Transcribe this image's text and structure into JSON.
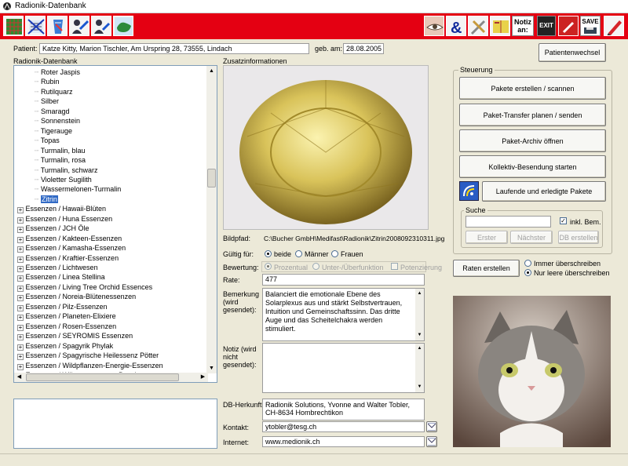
{
  "window": {
    "title": "Radionik-Datenbank"
  },
  "toolbar": {
    "notiz_label": "Notiz an:",
    "exit_label": "EXIT",
    "save_label": "SAVE"
  },
  "patient": {
    "label": "Patient:",
    "value": "Katze Kitty, Marion Tischler, Am Urspring 28, 73555, Lindach",
    "dob_label": "geb. am:",
    "dob_value": "28.08.2005",
    "switch_button": "Patientenwechsel"
  },
  "db_panel": {
    "label": "Radionik-Datenbank"
  },
  "tree": {
    "children": [
      "Roter Jaspis",
      "Rubin",
      "Rutilquarz",
      "Silber",
      "Smaragd",
      "Sonnenstein",
      "Tigerauge",
      "Topas",
      "Turmalin, blau",
      "Turmalin, rosa",
      "Turmalin, schwarz",
      "Violetter Sugilith",
      "Wassermelonen-Turmalin"
    ],
    "selected": "Zitrin",
    "groups": [
      "Essenzen / Hawaii-Blüten",
      "Essenzen / Huna Essenzen",
      "Essenzen / JCH Öle",
      "Essenzen / Kakteen-Essenzen",
      "Essenzen / Kamasha-Essenzen",
      "Essenzen / Kraftier-Essenzen",
      "Essenzen / Lichtwesen",
      "Essenzen / Linea Stellina",
      "Essenzen / Living Tree Orchid Essences",
      "Essenzen / Noreia-Blütenessenzen",
      "Essenzen / Pilz-Essenzen",
      "Essenzen / Planeten-Elixiere",
      "Essenzen / Rosen-Essenzen",
      "Essenzen / SEYROMIS Essenzen",
      "Essenzen / Spagyrik Phylak",
      "Essenzen / Spagyrische Heilessenz Pötter",
      "Essenzen / Wildpflanzen-Energie-Essenzen",
      "Essenzen / Wüstenessenzen Boavistas"
    ]
  },
  "info": {
    "label": "Zusatzinformationen",
    "bildpfad_label": "Bildpfad:",
    "bildpfad_value": "C:\\Bucher GmbH\\Medifast\\Radionik\\Zitrin2008092310311.jpg",
    "gueltig_label": "Gültig für:",
    "gueltig_options": [
      "beide",
      "Männer",
      "Frauen"
    ],
    "bewertung_label": "Bewertung:",
    "bewertung_options": [
      "Prozentual",
      "Unter-/Überfunktion",
      "Potenzierung"
    ],
    "rate_label": "Rate:",
    "rate_value": "477",
    "bemerkung_label": "Bemerkung (wird gesendet):",
    "bemerkung_value": "Balanciert die emotionale Ebene des Solarplexus aus und stärkt Selbstvertrauen, Intuition und Gemeinschaftssinn. Das dritte Auge und das Scheitelchakra werden stimuliert.",
    "notiz_label": "Notiz (wird nicht gesendet):",
    "notiz_value": "",
    "herkunft_label": "DB-Herkunft:",
    "herkunft_value": "Radionik Solutions, Yvonne and Walter Tobler, CH-8634 Hombrechtikon",
    "kontakt_label": "Kontakt:",
    "kontakt_value": "ytobler@tesg.ch",
    "internet_label": "Internet:",
    "internet_value": "www.medionik.ch"
  },
  "steuerung": {
    "label": "Steuerung",
    "buttons": [
      "Pakete erstellen / scannen",
      "Paket-Transfer planen / senden",
      "Paket-Archiv öffnen",
      "Kollektiv-Besendung starten",
      "Laufende und erledigte Pakete"
    ]
  },
  "suche": {
    "label": "Suche",
    "value": "",
    "inkl_label": "inkl. Bem.",
    "erster": "Erster",
    "naechster": "Nächster",
    "db_erstellen": "DB erstellen"
  },
  "raten": {
    "button": "Raten erstellen",
    "opt_immer": "Immer überschreiben",
    "opt_leer": "Nur leere überschreiben"
  },
  "colors": {
    "toolbar_red": "#e40012",
    "window_bg": "#ece9d8"
  }
}
